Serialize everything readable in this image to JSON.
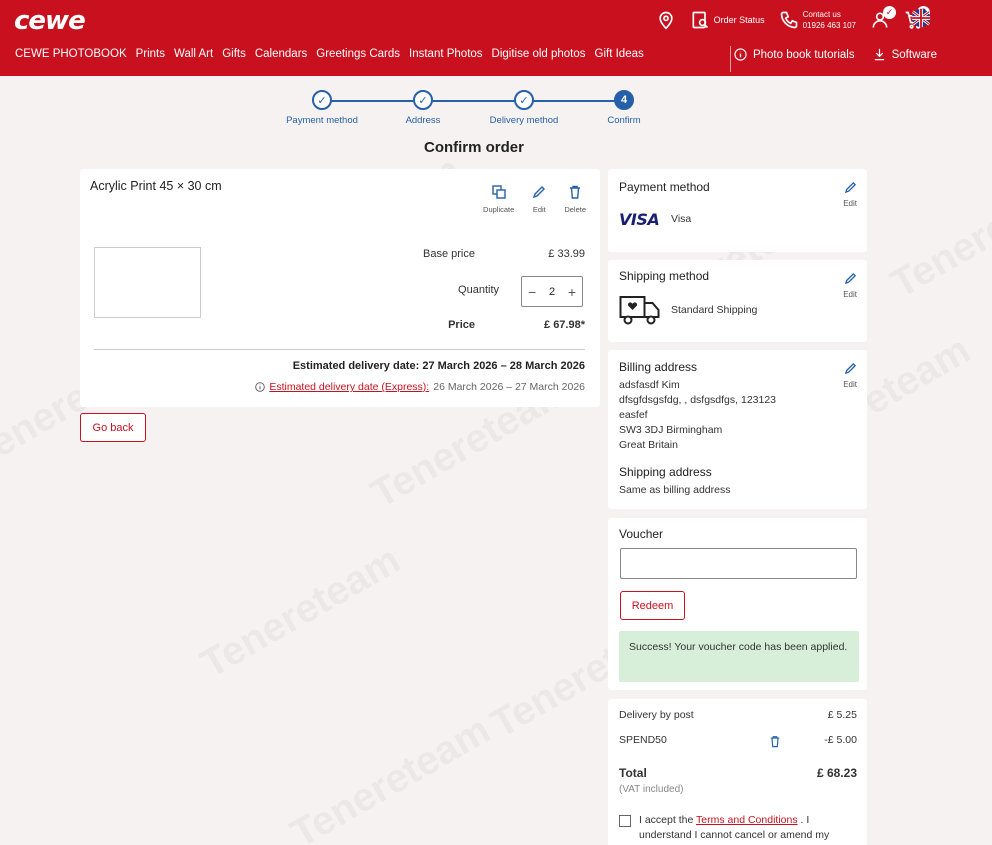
{
  "header": {
    "logo": "cewe",
    "order_status": "Order Status",
    "contact_line1": "Contact us",
    "contact_line2": "01926 463 107",
    "cart_count": "2",
    "nav": [
      "CEWE PHOTOBOOK",
      "Prints",
      "Wall Art",
      "Gifts",
      "Calendars",
      "Greetings Cards",
      "Instant Photos",
      "Digitise old photos",
      "Gift Ideas"
    ],
    "tutorials": "Photo book tutorials",
    "software": "Software",
    "brand_color": "#c8101e"
  },
  "stepper": {
    "steps": [
      {
        "label": "Payment method",
        "state": "done"
      },
      {
        "label": "Address",
        "state": "done"
      },
      {
        "label": "Delivery method",
        "state": "done"
      },
      {
        "label": "Confirm",
        "number": "4",
        "state": "active"
      }
    ]
  },
  "page_title": "Confirm order",
  "product": {
    "title": "Acrylic Print 45 × 30 cm",
    "duplicate": "Duplicate",
    "edit": "Edit",
    "delete": "Delete",
    "base_price_label": "Base price",
    "base_price": "£ 33.99",
    "quantity_label": "Quantity",
    "quantity": "2",
    "price_label": "Price",
    "price": "£ 67.98*",
    "delivery_label": "Estimated delivery date:",
    "delivery_dates": "27 March 2026 – 28 March 2026",
    "express_link": "Estimated delivery date (Express):",
    "express_dates": "26 March 2026 – 27 March 2026"
  },
  "go_back": "Go back",
  "payment": {
    "title": "Payment method",
    "card_brand": "VISA",
    "card_name": "Visa",
    "edit": "Edit"
  },
  "shipping_method": {
    "title": "Shipping method",
    "value": "Standard Shipping",
    "edit": "Edit"
  },
  "billing": {
    "title": "Billing address",
    "lines": [
      "adsfasdf Kim",
      "dfsgfdsgsfdg, , dsfgsdfgs, 123123",
      "easfef",
      "SW3 3DJ Birmingham",
      "Great Britain"
    ],
    "edit": "Edit",
    "shipping_title": "Shipping address",
    "shipping_value": "Same as billing address"
  },
  "voucher": {
    "title": "Voucher",
    "input_value": "",
    "redeem": "Redeem",
    "success": "Success! Your voucher code has been applied."
  },
  "summary": {
    "delivery_label": "Delivery by post",
    "delivery_value": "£ 5.25",
    "code": "SPEND50",
    "code_value": "-£ 5.00",
    "total_label": "Total",
    "total_value": "£ 68.23",
    "vat_note": "(VAT included)",
    "terms_pre": "I accept the",
    "terms_link": "Terms and Conditions",
    "terms_post": ". I understand I cannot cancel or amend my"
  },
  "watermark": "Tenereteam"
}
